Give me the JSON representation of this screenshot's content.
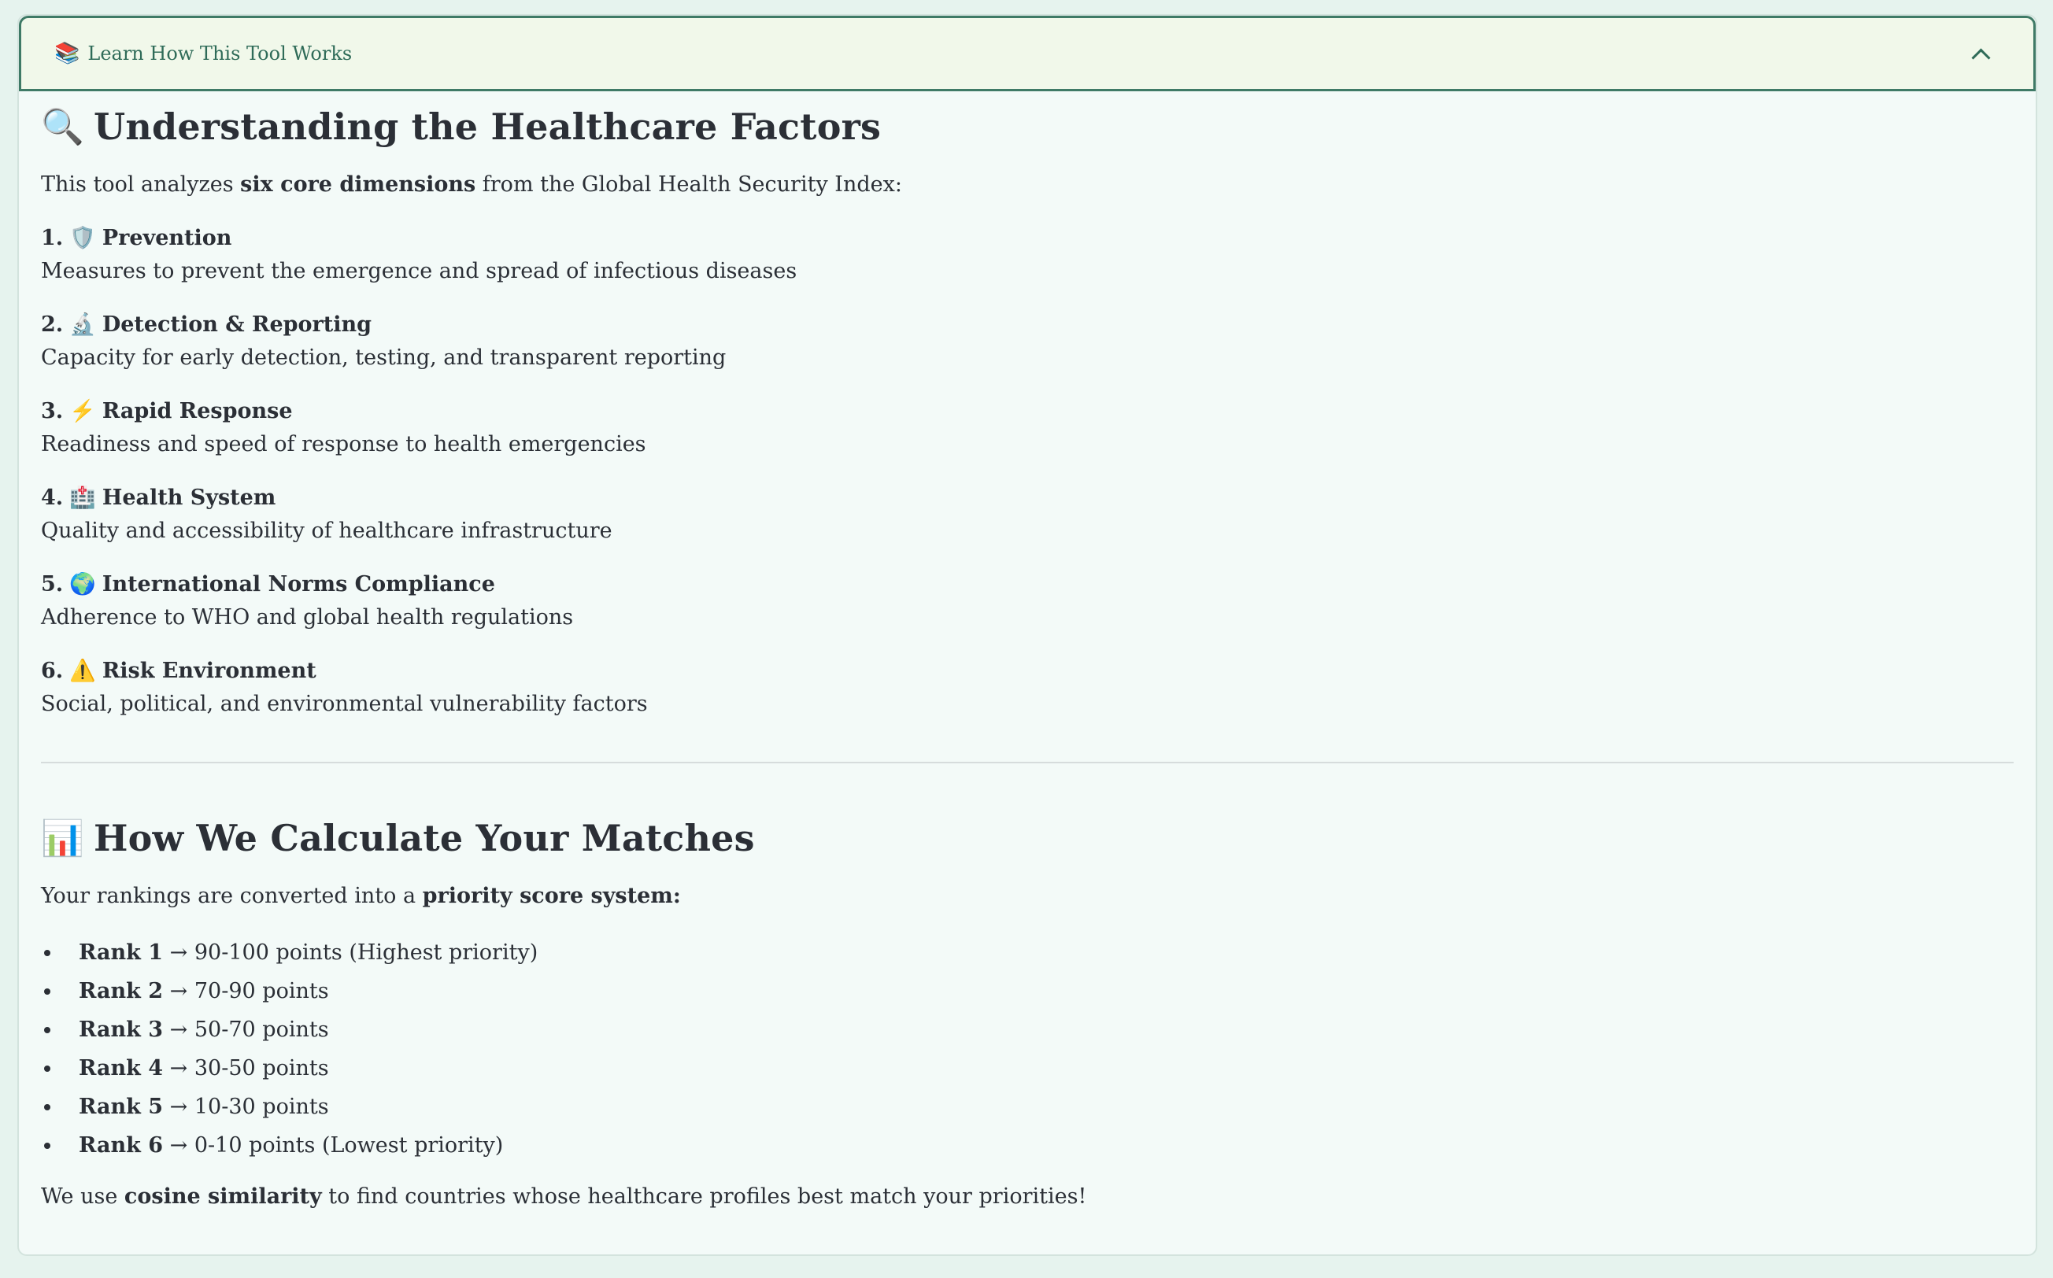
{
  "expander": {
    "emoji": "📚",
    "label": "Learn How This Tool Works"
  },
  "factors_section": {
    "emoji": "🔍",
    "title": "Understanding the Healthcare Factors",
    "intro_prefix": "This tool analyzes ",
    "intro_bold": "six core dimensions",
    "intro_suffix": " from the Global Health Security Index:",
    "items": [
      {
        "number": "1.",
        "emoji": "🛡️",
        "title": "Prevention",
        "description": "Measures to prevent the emergence and spread of infectious diseases"
      },
      {
        "number": "2.",
        "emoji": "🔬",
        "title": "Detection & Reporting",
        "description": "Capacity for early detection, testing, and transparent reporting"
      },
      {
        "number": "3.",
        "emoji": "⚡",
        "title": "Rapid Response",
        "description": "Readiness and speed of response to health emergencies"
      },
      {
        "number": "4.",
        "emoji": "🏥",
        "title": "Health System",
        "description": "Quality and accessibility of healthcare infrastructure"
      },
      {
        "number": "5.",
        "emoji": "🌍",
        "title": "International Norms Compliance",
        "description": "Adherence to WHO and global health regulations"
      },
      {
        "number": "6.",
        "emoji": "⚠️",
        "title": "Risk Environment",
        "description": "Social, political, and environmental vulnerability factors"
      }
    ]
  },
  "matches_section": {
    "emoji": "📊",
    "title": "How We Calculate Your Matches",
    "intro_prefix": "Your rankings are converted into a ",
    "intro_bold": "priority score system:",
    "ranks": [
      {
        "label": "Rank 1",
        "text": "→ 90-100 points (Highest priority)"
      },
      {
        "label": "Rank 2",
        "text": "→ 70-90 points"
      },
      {
        "label": "Rank 3",
        "text": "→ 50-70 points"
      },
      {
        "label": "Rank 4",
        "text": "→ 30-50 points"
      },
      {
        "label": "Rank 5",
        "text": "→ 10-30 points"
      },
      {
        "label": "Rank 6",
        "text": "→ 0-10 points (Lowest priority)"
      }
    ],
    "outro_prefix": "We use ",
    "outro_bold": "cosine similarity",
    "outro_suffix": " to find countries whose healthcare profiles best match your priorities!"
  },
  "colors": {
    "page_background": "#e6f3ee",
    "expander_header_bg": "#f1f8ea",
    "expander_border": "#3f7a66",
    "accent_text": "#2f6b58",
    "body_text": "#2b2f36"
  }
}
